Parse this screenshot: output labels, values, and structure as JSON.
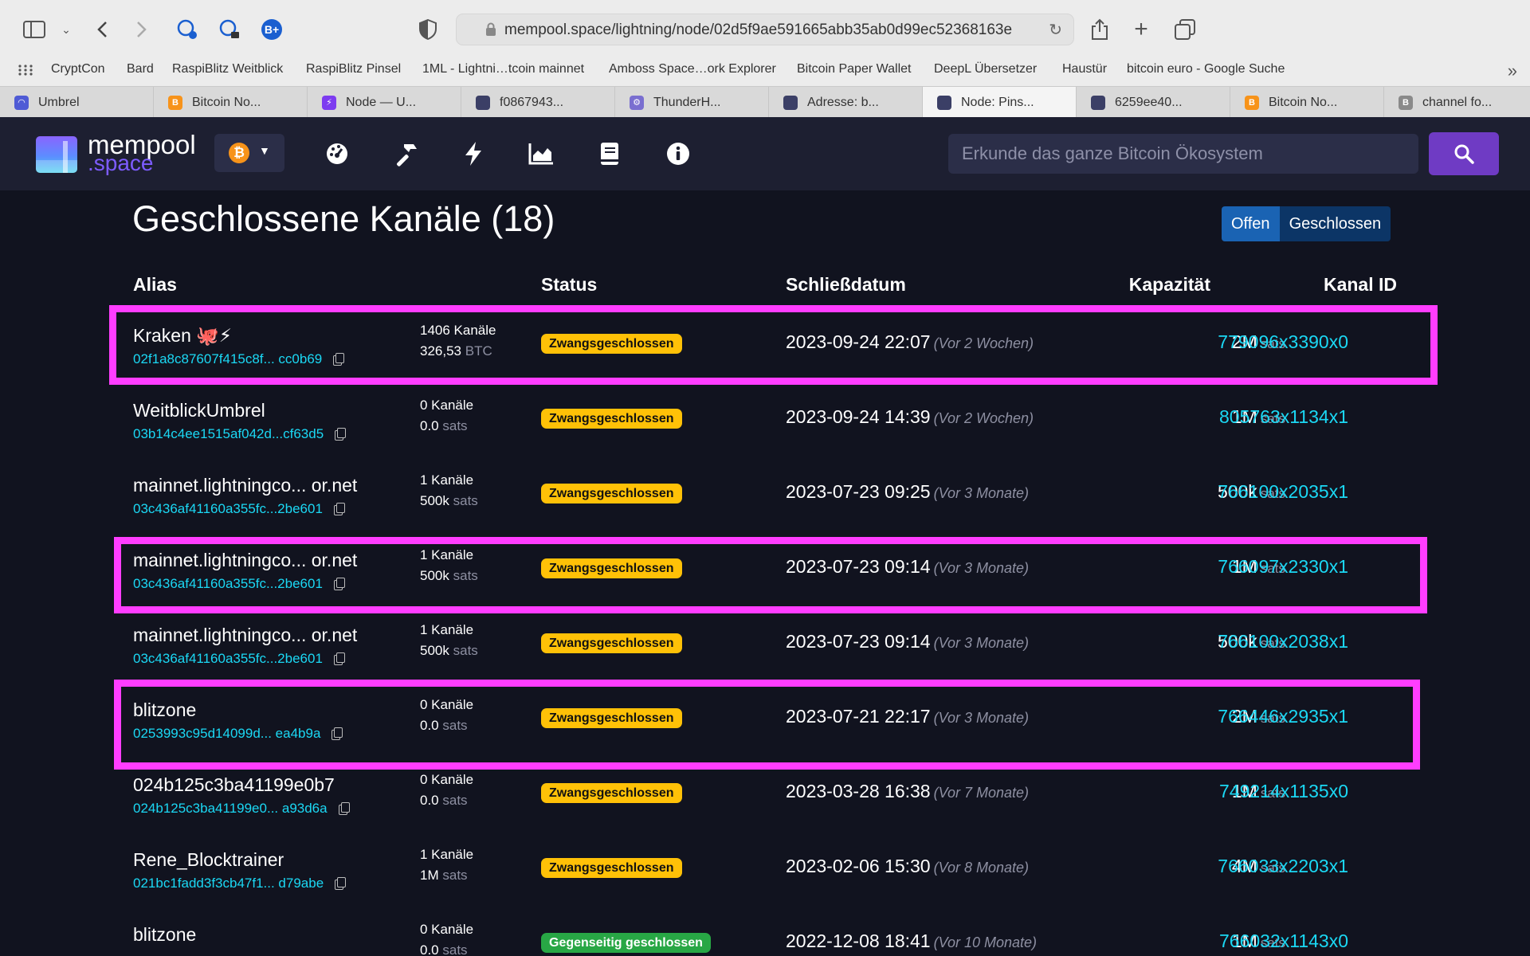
{
  "browser": {
    "url": "mempool.space/lightning/node/02d5f9ae591665abb35ab0d99ec52368163e",
    "bookmarks": [
      "CryptCon",
      "Bard",
      "RaspiBlitz Weitblick",
      "RaspiBlitz Pinsel",
      "1ML - Lightni…tcoin mainnet",
      "Amboss Space…ork Explorer",
      "Bitcoin Paper Wallet",
      "DeepL Übersetzer",
      "Haustür",
      "bitcoin euro - Google Suche"
    ],
    "tabs": [
      {
        "label": "Umbrel",
        "color": "#4f5bd5",
        "glyph": "◠"
      },
      {
        "label": "Bitcoin No...",
        "color": "#f7931a",
        "glyph": "B"
      },
      {
        "label": "Node — U...",
        "color": "#7d3cf0",
        "glyph": "⚡"
      },
      {
        "label": "f0867943...",
        "color": "#3b3f66",
        "glyph": ""
      },
      {
        "label": "ThunderH...",
        "color": "#7a6fd0",
        "glyph": "⚙"
      },
      {
        "label": "Adresse: b...",
        "color": "#3b3f66",
        "glyph": ""
      },
      {
        "label": "Node: Pins...",
        "color": "#3b3f66",
        "glyph": ""
      },
      {
        "label": "6259ee40...",
        "color": "#3b3f66",
        "glyph": ""
      },
      {
        "label": "Bitcoin No...",
        "color": "#f7931a",
        "glyph": "B"
      },
      {
        "label": "channel fo...",
        "color": "#8a8a8a",
        "glyph": "B"
      }
    ]
  },
  "header": {
    "logo_line1": "mempool",
    "logo_line2": ".space",
    "network_symbol": "₿",
    "nav_icons": [
      "dashboard-icon",
      "mining-hammer-icon",
      "lightning-icon",
      "graphs-icon",
      "docs-book-icon",
      "about-info-icon"
    ],
    "search_placeholder": "Erkunde das ganze Bitcoin Ökosystem"
  },
  "main": {
    "title": "Geschlossene Kanäle (18)",
    "toggle": {
      "open_label": "Offen",
      "closed_label": "Geschlossen",
      "selected": "Geschlossen"
    },
    "columns": {
      "alias": "Alias",
      "status": "Status",
      "close_date": "Schließdatum",
      "capacity": "Kapazität",
      "channel_id": "Kanal ID"
    },
    "rows": [
      {
        "alias": "Kraken 🐙⚡",
        "pubkey": "02f1a8c87607f415c8f... cc0b69",
        "channels": "1406 Kanäle",
        "cap_value": "326,53",
        "cap_unit": "BTC",
        "status": "Zwangsgeschlossen",
        "status_type": "forced",
        "date": "2023-09-24 22:07",
        "ago": "(Vor 2 Wochen)",
        "capacity": "2M",
        "capacity_unit": "sats",
        "channel_id": "779096x3390x0",
        "highlighted": true
      },
      {
        "alias": "WeitblickUmbrel",
        "pubkey": "03b14c4ee1515af042d...cf63d5",
        "channels": "0 Kanäle",
        "cap_value": "0.0",
        "cap_unit": "sats",
        "status": "Zwangsgeschlossen",
        "status_type": "forced",
        "date": "2023-09-24 14:39",
        "ago": "(Vor 2 Wochen)",
        "capacity": "1M",
        "capacity_unit": "sats",
        "channel_id": "805763x1134x1",
        "highlighted": false
      },
      {
        "alias": "mainnet.lightningco... or.net",
        "pubkey": "03c436af41160a355fc...2be601",
        "channels": "1 Kanäle",
        "cap_value": "500k",
        "cap_unit": "sats",
        "status": "Zwangsgeschlossen",
        "status_type": "forced",
        "date": "2023-07-23 09:25",
        "ago": "(Vor 3 Monate)",
        "capacity": "500k",
        "capacity_unit": "sats",
        "channel_id": "766100x2035x1",
        "highlighted": false
      },
      {
        "alias": "mainnet.lightningco... or.net",
        "pubkey": "03c436af41160a355fc...2be601",
        "channels": "1 Kanäle",
        "cap_value": "500k",
        "cap_unit": "sats",
        "status": "Zwangsgeschlossen",
        "status_type": "forced",
        "date": "2023-07-23 09:14",
        "ago": "(Vor 3 Monate)",
        "capacity": "1M",
        "capacity_unit": "sats",
        "channel_id": "766097x2330x1",
        "highlighted": true
      },
      {
        "alias": "mainnet.lightningco... or.net",
        "pubkey": "03c436af41160a355fc...2be601",
        "channels": "1 Kanäle",
        "cap_value": "500k",
        "cap_unit": "sats",
        "status": "Zwangsgeschlossen",
        "status_type": "forced",
        "date": "2023-07-23 09:14",
        "ago": "(Vor 3 Monate)",
        "capacity": "500k",
        "capacity_unit": "sats",
        "channel_id": "766100x2038x1",
        "highlighted": false
      },
      {
        "alias": "blitzone",
        "pubkey": "0253993c95d14099d... ea4b9a",
        "channels": "0 Kanäle",
        "cap_value": "0.0",
        "cap_unit": "sats",
        "status": "Zwangsgeschlossen",
        "status_type": "forced",
        "date": "2023-07-21 22:17",
        "ago": "(Vor 3 Monate)",
        "capacity": "2M",
        "capacity_unit": "sats",
        "channel_id": "766446x2935x1",
        "highlighted": true
      },
      {
        "alias": "024b125c3ba41199e0b7",
        "pubkey": "024b125c3ba41199e0... a93d6a",
        "channels": "0 Kanäle",
        "cap_value": "0.0",
        "cap_unit": "sats",
        "status": "Zwangsgeschlossen",
        "status_type": "forced",
        "date": "2023-03-28 16:38",
        "ago": "(Vor 7 Monate)",
        "capacity": "1M",
        "capacity_unit": "sats",
        "channel_id": "749214x1135x0",
        "highlighted": false
      },
      {
        "alias": "Rene_Blocktrainer",
        "pubkey": "021bc1fadd3f3cb47f1... d79abe",
        "channels": "1 Kanäle",
        "cap_value": "1M",
        "cap_unit": "sats",
        "status": "Zwangsgeschlossen",
        "status_type": "forced",
        "date": "2023-02-06 15:30",
        "ago": "(Vor 8 Monate)",
        "capacity": "4M",
        "capacity_unit": "sats",
        "channel_id": "766033x2203x1",
        "highlighted": false
      },
      {
        "alias": "blitzone",
        "pubkey": "",
        "channels": "0 Kanäle",
        "cap_value": "0.0",
        "cap_unit": "sats",
        "status": "Gegenseitig geschlossen",
        "status_type": "mutual",
        "date": "2022-12-08 18:41",
        "ago": "(Vor 10 Monate)",
        "capacity": "1M",
        "capacity_unit": "sats",
        "channel_id": "766032x1143x0",
        "highlighted": false
      }
    ]
  },
  "colors": {
    "highlight_frame": "#ff3dff",
    "link": "#1bd8f4",
    "forced_badge": "#ffc107",
    "mutual_badge": "#28a745",
    "search_button": "#6f3bc4"
  }
}
